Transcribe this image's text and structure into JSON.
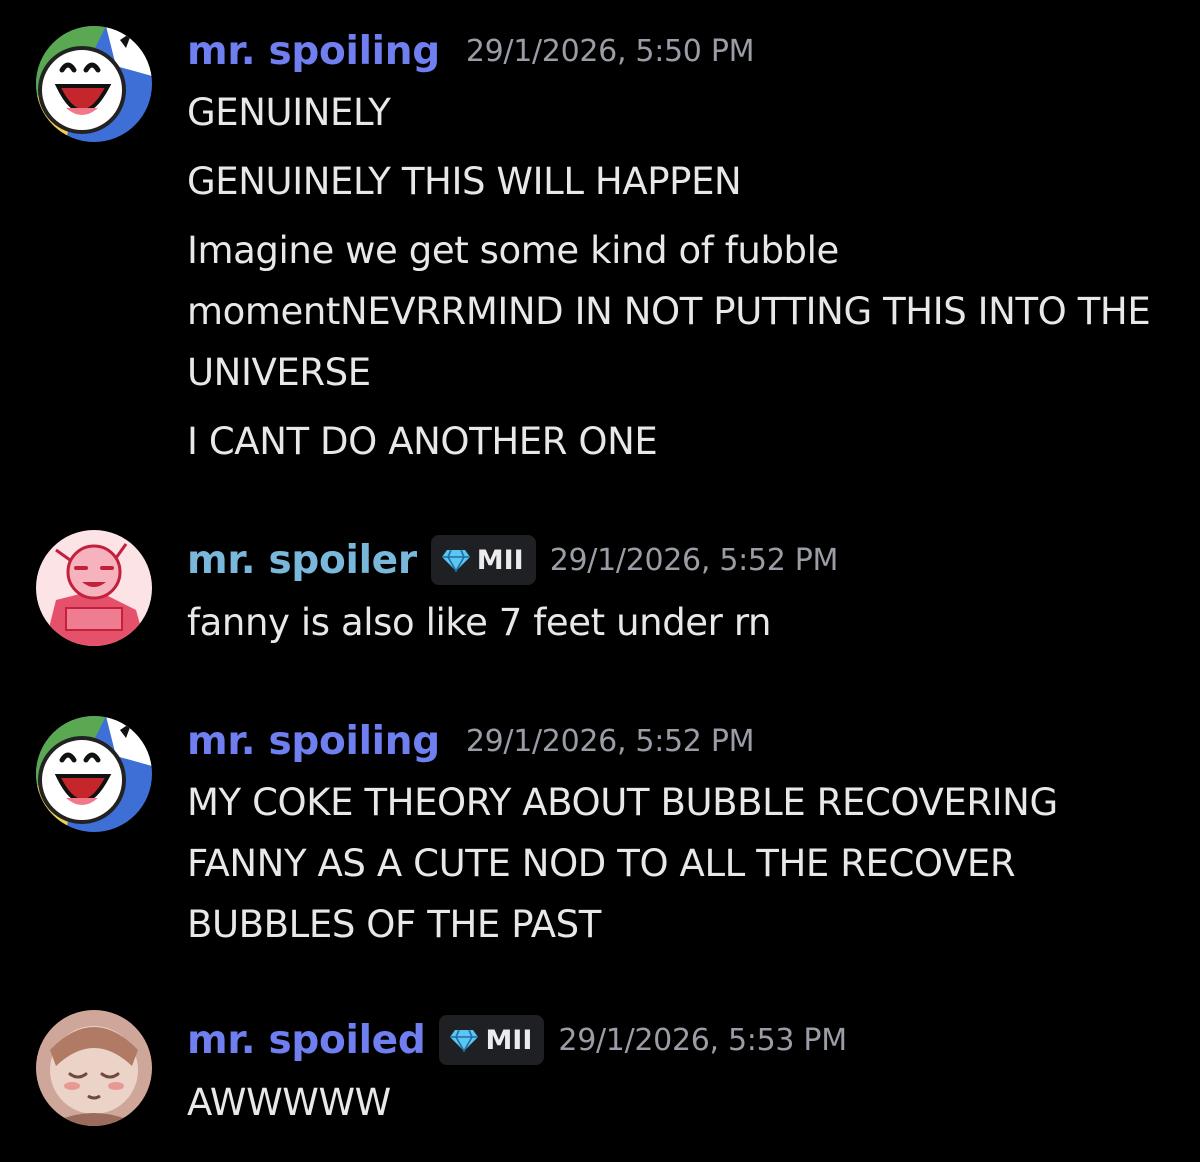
{
  "messages": [
    {
      "username": "mr. spoiling",
      "timestamp": "29/1/2026, 5:50 PM",
      "avatar_icon": "grinning-face-avatar-icon",
      "lines": [
        "GENUINELY",
        "GENUINELY THIS WILL HAPPEN",
        "Imagine we get some kind of fubble momentNEVRRMIND IN NOT PUTTING THIS INTO THE UNIVERSE",
        "I CANT DO ANOTHER ONE"
      ]
    },
    {
      "username": "mr. spoiler",
      "badge": "MII",
      "timestamp": "29/1/2026, 5:52 PM",
      "avatar_icon": "red-sketch-avatar-icon",
      "lines": [
        "fanny is also like 7 feet under rn"
      ]
    },
    {
      "username": "mr. spoiling",
      "timestamp": "29/1/2026, 5:52 PM",
      "avatar_icon": "grinning-face-avatar-icon",
      "lines": [
        "MY COKE THEORY ABOUT BUBBLE RECOVERING FANNY AS A CUTE NOD TO ALL THE RECOVER BUBBLES OF THE PAST"
      ]
    },
    {
      "username": "mr. spoiled",
      "badge": "MII",
      "timestamp": "29/1/2026, 5:53 PM",
      "avatar_icon": "sleepy-character-avatar-icon",
      "lines": [
        "AWWWWW"
      ]
    }
  ],
  "colors": {
    "background": "#000000",
    "username_blue": "#6f7ff0",
    "username_teal": "#79b8da",
    "timestamp": "#9a9ca6",
    "message_text": "#e8e8ea",
    "badge_bg": "#1f2024"
  }
}
